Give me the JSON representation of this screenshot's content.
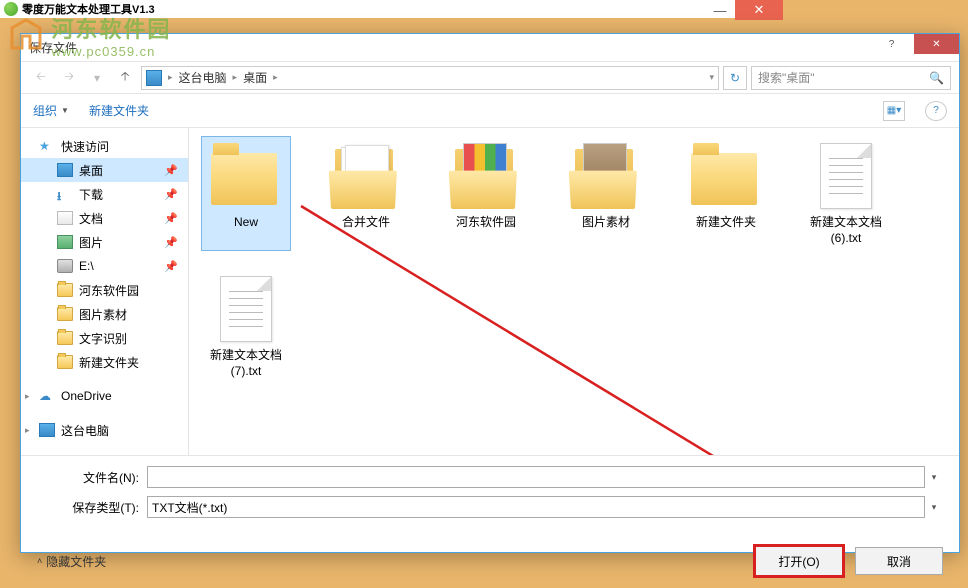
{
  "parent": {
    "title": "零度万能文本处理工具V1.3"
  },
  "watermark": {
    "cn": "河东软件园",
    "url": "www.pc0359.cn"
  },
  "dialog": {
    "title": "保存文件"
  },
  "nav": {
    "breadcrumb": {
      "seg1": "这台电脑",
      "seg2": "桌面"
    },
    "search_placeholder": "搜索\"桌面\""
  },
  "toolbar": {
    "organize": "组织",
    "new_folder": "新建文件夹"
  },
  "sidebar": {
    "quick": "快速访问",
    "desktop": "桌面",
    "downloads": "下载",
    "documents": "文档",
    "pictures": "图片",
    "drive_e": "E:\\",
    "folder1": "河东软件园",
    "folder2": "图片素材",
    "folder3": "文字识别",
    "folder4": "新建文件夹",
    "onedrive": "OneDrive",
    "thispc": "这台电脑"
  },
  "files": {
    "f0": "New",
    "f1": "合并文件",
    "f2": "河东软件园",
    "f3": "图片素材",
    "f4": "新建文件夹",
    "f5": "新建文本文档(6).txt",
    "f6": "新建文本文档(7).txt"
  },
  "bottom": {
    "filename_label": "文件名(N):",
    "filetype_label": "保存类型(T):",
    "filetype_value": "TXT文档(*.txt)",
    "hide_folders": "隐藏文件夹",
    "open_btn": "打开(O)",
    "cancel_btn": "取消"
  }
}
